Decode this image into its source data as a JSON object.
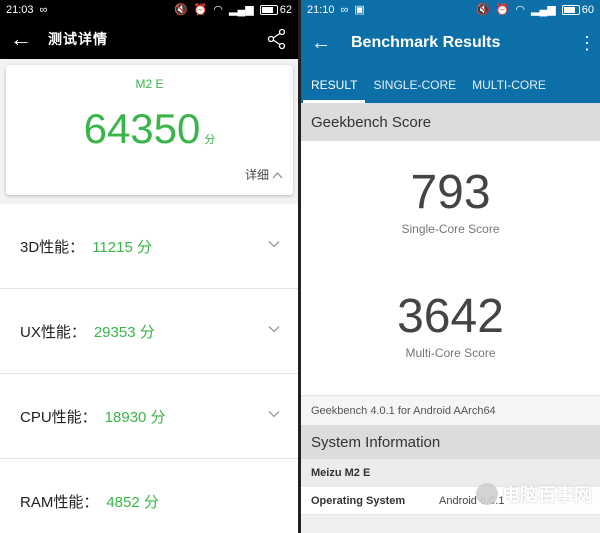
{
  "left": {
    "status": {
      "time": "21:03",
      "battery": "62"
    },
    "appbar": {
      "title": "测试详情"
    },
    "card": {
      "model": "M2 E",
      "score": "64350",
      "unit": "分",
      "detail_label": "详细"
    },
    "rows": [
      {
        "label": "3D性能：",
        "value": "11215 分"
      },
      {
        "label": "UX性能：",
        "value": "29353 分"
      },
      {
        "label": "CPU性能：",
        "value": "18930 分"
      },
      {
        "label": "RAM性能：",
        "value": "4852 分"
      }
    ]
  },
  "right": {
    "status": {
      "time": "21:10",
      "battery": "60"
    },
    "appbar": {
      "title": "Benchmark Results"
    },
    "tabs": [
      "RESULT",
      "SINGLE-CORE",
      "MULTI-CORE"
    ],
    "score_header": "Geekbench Score",
    "single": {
      "value": "793",
      "label": "Single-Core Score"
    },
    "multi": {
      "value": "3642",
      "label": "Multi-Core Score"
    },
    "version": "Geekbench 4.0.1 for Android AArch64",
    "sysinfo_header": "System Information",
    "sysinfo": [
      {
        "key": "Meizu M2 E",
        "value": ""
      },
      {
        "key": "Operating System",
        "value": "Android 6.0.1"
      }
    ],
    "watermark": "电脑百事网"
  },
  "colors": {
    "accent_green": "#3ab54a",
    "geekbench_blue": "#0d6fa8"
  }
}
